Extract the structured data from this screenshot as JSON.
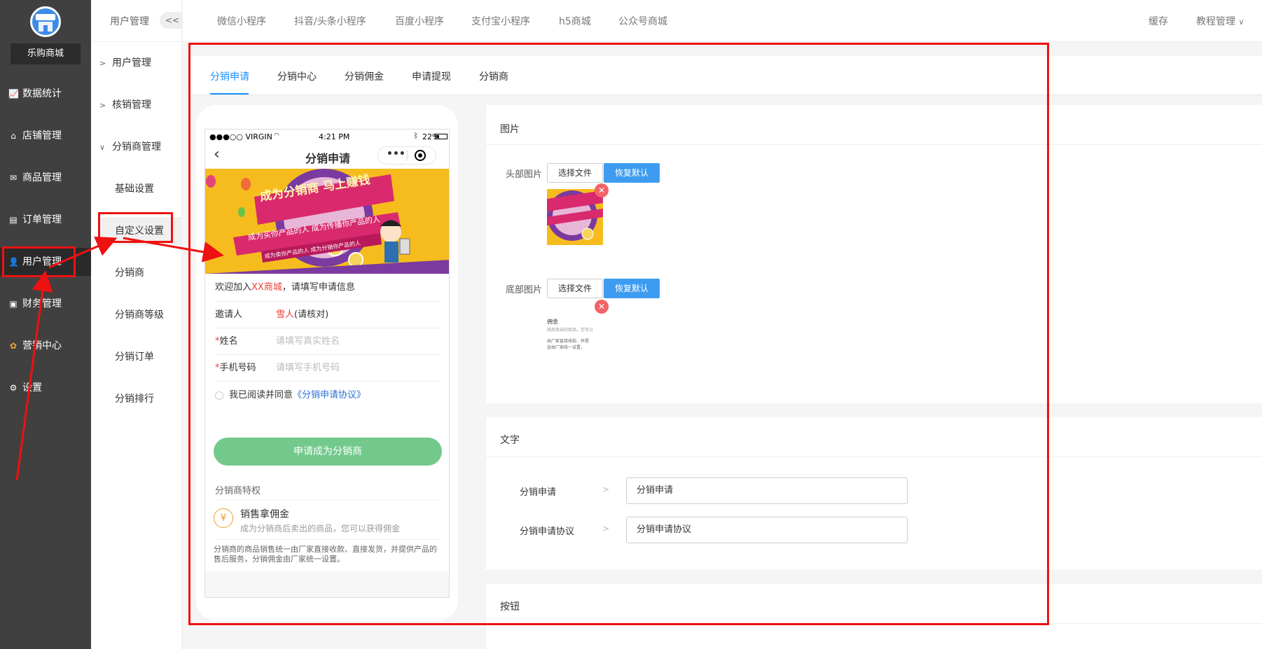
{
  "sidebar": {
    "shop_name": "乐购商城",
    "items": [
      {
        "label": "数据统计",
        "icon": "chart-icon"
      },
      {
        "label": "店铺管理",
        "icon": "store-icon"
      },
      {
        "label": "商品管理",
        "icon": "goods-icon"
      },
      {
        "label": "订单管理",
        "icon": "order-icon"
      },
      {
        "label": "用户管理",
        "icon": "user-icon"
      },
      {
        "label": "财务管理",
        "icon": "finance-icon"
      },
      {
        "label": "营销中心",
        "icon": "marketing-icon"
      },
      {
        "label": "设置",
        "icon": "settings-icon"
      }
    ]
  },
  "subnav": {
    "title": "用户管理",
    "collapse": "<<",
    "groups": [
      "用户管理",
      "核销管理",
      "分销商管理"
    ],
    "children": [
      "基础设置",
      "自定义设置",
      "分销商",
      "分销商等级",
      "分销订单",
      "分销排行"
    ]
  },
  "topbar": {
    "tabs": [
      "微信小程序",
      "抖音/头条小程序",
      "百度小程序",
      "支付宝小程序",
      "h5商城",
      "公众号商城"
    ],
    "cache": "缓存",
    "tutorial": "教程管理"
  },
  "tabs": [
    "分销申请",
    "分销中心",
    "分销佣金",
    "申请提现",
    "分销商"
  ],
  "phone": {
    "carrier": "●●●○○ VIRGIN",
    "time": "4:21 PM",
    "battery": "22%",
    "page_title": "分销申请",
    "banner_main": "成为分销商 马上赚钱",
    "banner_sub1": "成为买你产品的人 成为传播你产品的人",
    "banner_sub2": "成为卖你产品的人 成为分销你产品的人",
    "welcome_prefix": "欢迎加入",
    "welcome_shop": "XX商城",
    "welcome_suffix": "，请填写申请信息",
    "inviter_label": "邀请人",
    "inviter_name": "雪人",
    "inviter_note": "(请核对)",
    "name_label": "姓名",
    "name_placeholder": "请填写真实姓名",
    "phone_label": "手机号码",
    "phone_placeholder": "请填写手机号码",
    "agree_text": "我已阅读并同意",
    "agree_link": "《分销申请协议》",
    "apply_button": "申请成为分销商",
    "privilege_title": "分销商特权",
    "privilege_name": "销售拿佣金",
    "privilege_desc": "成为分销商后卖出的商品，您可以获得佣金",
    "footer_note": "分销商的商品销售统一由厂家直接收款、直接发货，并提供产品的售后服务，分销佣金由厂家统一设置。"
  },
  "images_panel": {
    "title": "图片",
    "header_label": "头部图片",
    "footer_label": "底部图片",
    "choose_file": "选择文件",
    "restore_default": "恢复默认",
    "footer_thumb_title": "佣金",
    "footer_thumb_line1": "商后卖出的商品，您可以",
    "footer_thumb_line2": "由厂家直接收款、并提",
    "footer_thumb_line3": "金由厂家统一设置。"
  },
  "text_panel": {
    "title": "文字",
    "fields": [
      {
        "label": "分销申请",
        "value": "分销申请"
      },
      {
        "label": "分销申请协议",
        "value": "分销申请协议"
      }
    ]
  },
  "button_panel": {
    "title": "按钮"
  },
  "colors": {
    "accent": "#1890ff",
    "annotation": "#ee1111",
    "apply_button": "#72c98b",
    "sidebar": "#404040"
  }
}
